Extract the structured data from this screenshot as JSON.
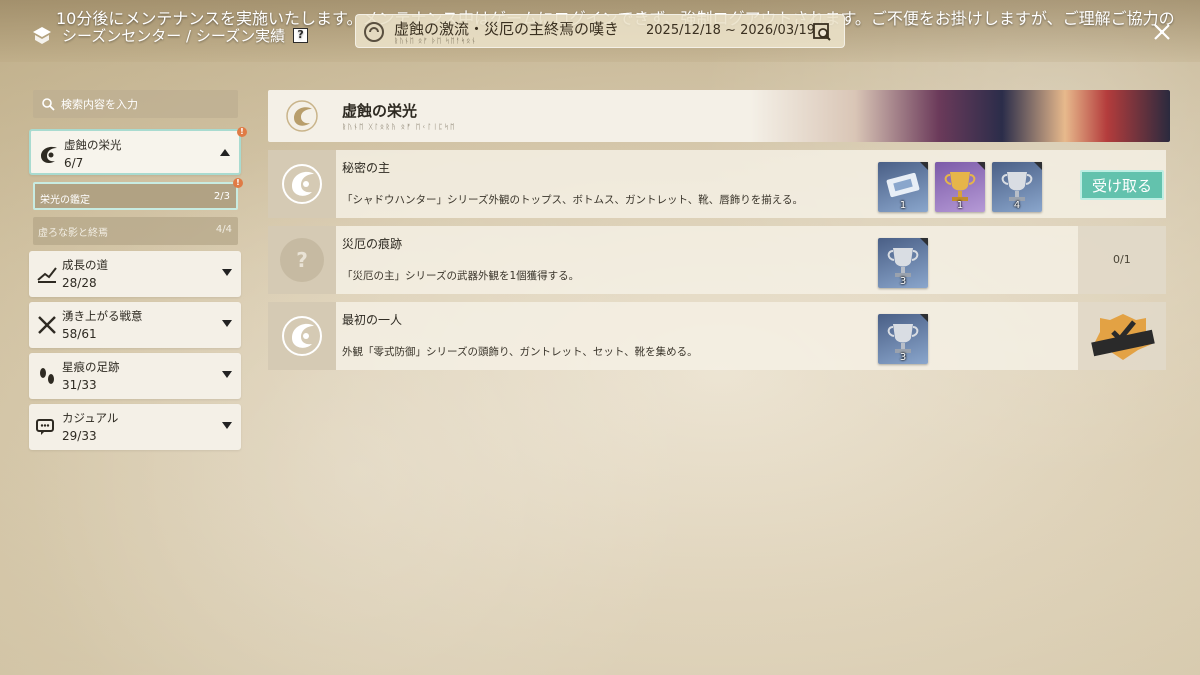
{
  "header": {
    "notice": "10分後にメンテナンスを実施いたします。メンテナンス中はゲームにログインできず、強制ログアウトされます。ご不便をお掛けしますが、ご理解ご協力の",
    "title": "シーズンセンター / シーズン実績",
    "help_label": "?",
    "season_name": "虚蝕の激流・災厄の主終焉の嘆き",
    "season_dates": "2025/12/18 ~ 2026/03/19"
  },
  "sidebar": {
    "search_placeholder": "検索内容を入力",
    "categories": [
      {
        "name": "虚蝕の栄光",
        "count": "6/7",
        "icon": "eclipse-glory-icon",
        "expanded": true,
        "alert": true
      },
      {
        "name": "成長の道",
        "count": "28/28",
        "icon": "growth-path-icon",
        "expanded": false
      },
      {
        "name": "湧き上がる戦意",
        "count": "58/61",
        "icon": "crossed-swords-icon",
        "expanded": false
      },
      {
        "name": "星痕の足跡",
        "count": "31/33",
        "icon": "footprint-icon",
        "expanded": false
      },
      {
        "name": "カジュアル",
        "count": "29/33",
        "icon": "chat-icon",
        "expanded": false
      }
    ],
    "subcategories": [
      {
        "name": "栄光の鑑定",
        "count": "2/3",
        "selected": true,
        "alert": true
      },
      {
        "name": "虚ろな影と終焉",
        "count": "4/4",
        "selected": false
      }
    ],
    "alert_mark": "!"
  },
  "main": {
    "section_title": "虚蝕の栄光",
    "achievements": [
      {
        "title": "秘密の主",
        "desc": "「シャドウハンター」シリーズ外観のトップス、ボトムス、ガントレット、靴、唇飾りを揃える。",
        "rewards": [
          {
            "icon": "ticket-icon",
            "qty": "1",
            "rarity": "blue"
          },
          {
            "icon": "gold-trophy-icon",
            "qty": "1",
            "rarity": "purple"
          },
          {
            "icon": "silver-trophy-icon",
            "qty": "4",
            "rarity": "blue"
          }
        ],
        "status": "claimable",
        "claim_label": "受け取る"
      },
      {
        "title": "災厄の痕跡",
        "desc": "「災厄の主」シリーズの武器外観を1個獲得する。",
        "rewards": [
          {
            "icon": "silver-trophy-icon",
            "qty": "3",
            "rarity": "blue"
          }
        ],
        "status": "in-progress",
        "progress": "0/1"
      },
      {
        "title": "最初の一人",
        "desc": "外観「零式防御」シリーズの頭飾り、ガントレット、セット、靴を集める。",
        "rewards": [
          {
            "icon": "silver-trophy-icon",
            "qty": "3",
            "rarity": "blue"
          }
        ],
        "status": "completed"
      }
    ]
  },
  "colors": {
    "accent_teal": "#63c2ad",
    "panel": "#f4f0e7",
    "alert": "#e07b45"
  }
}
